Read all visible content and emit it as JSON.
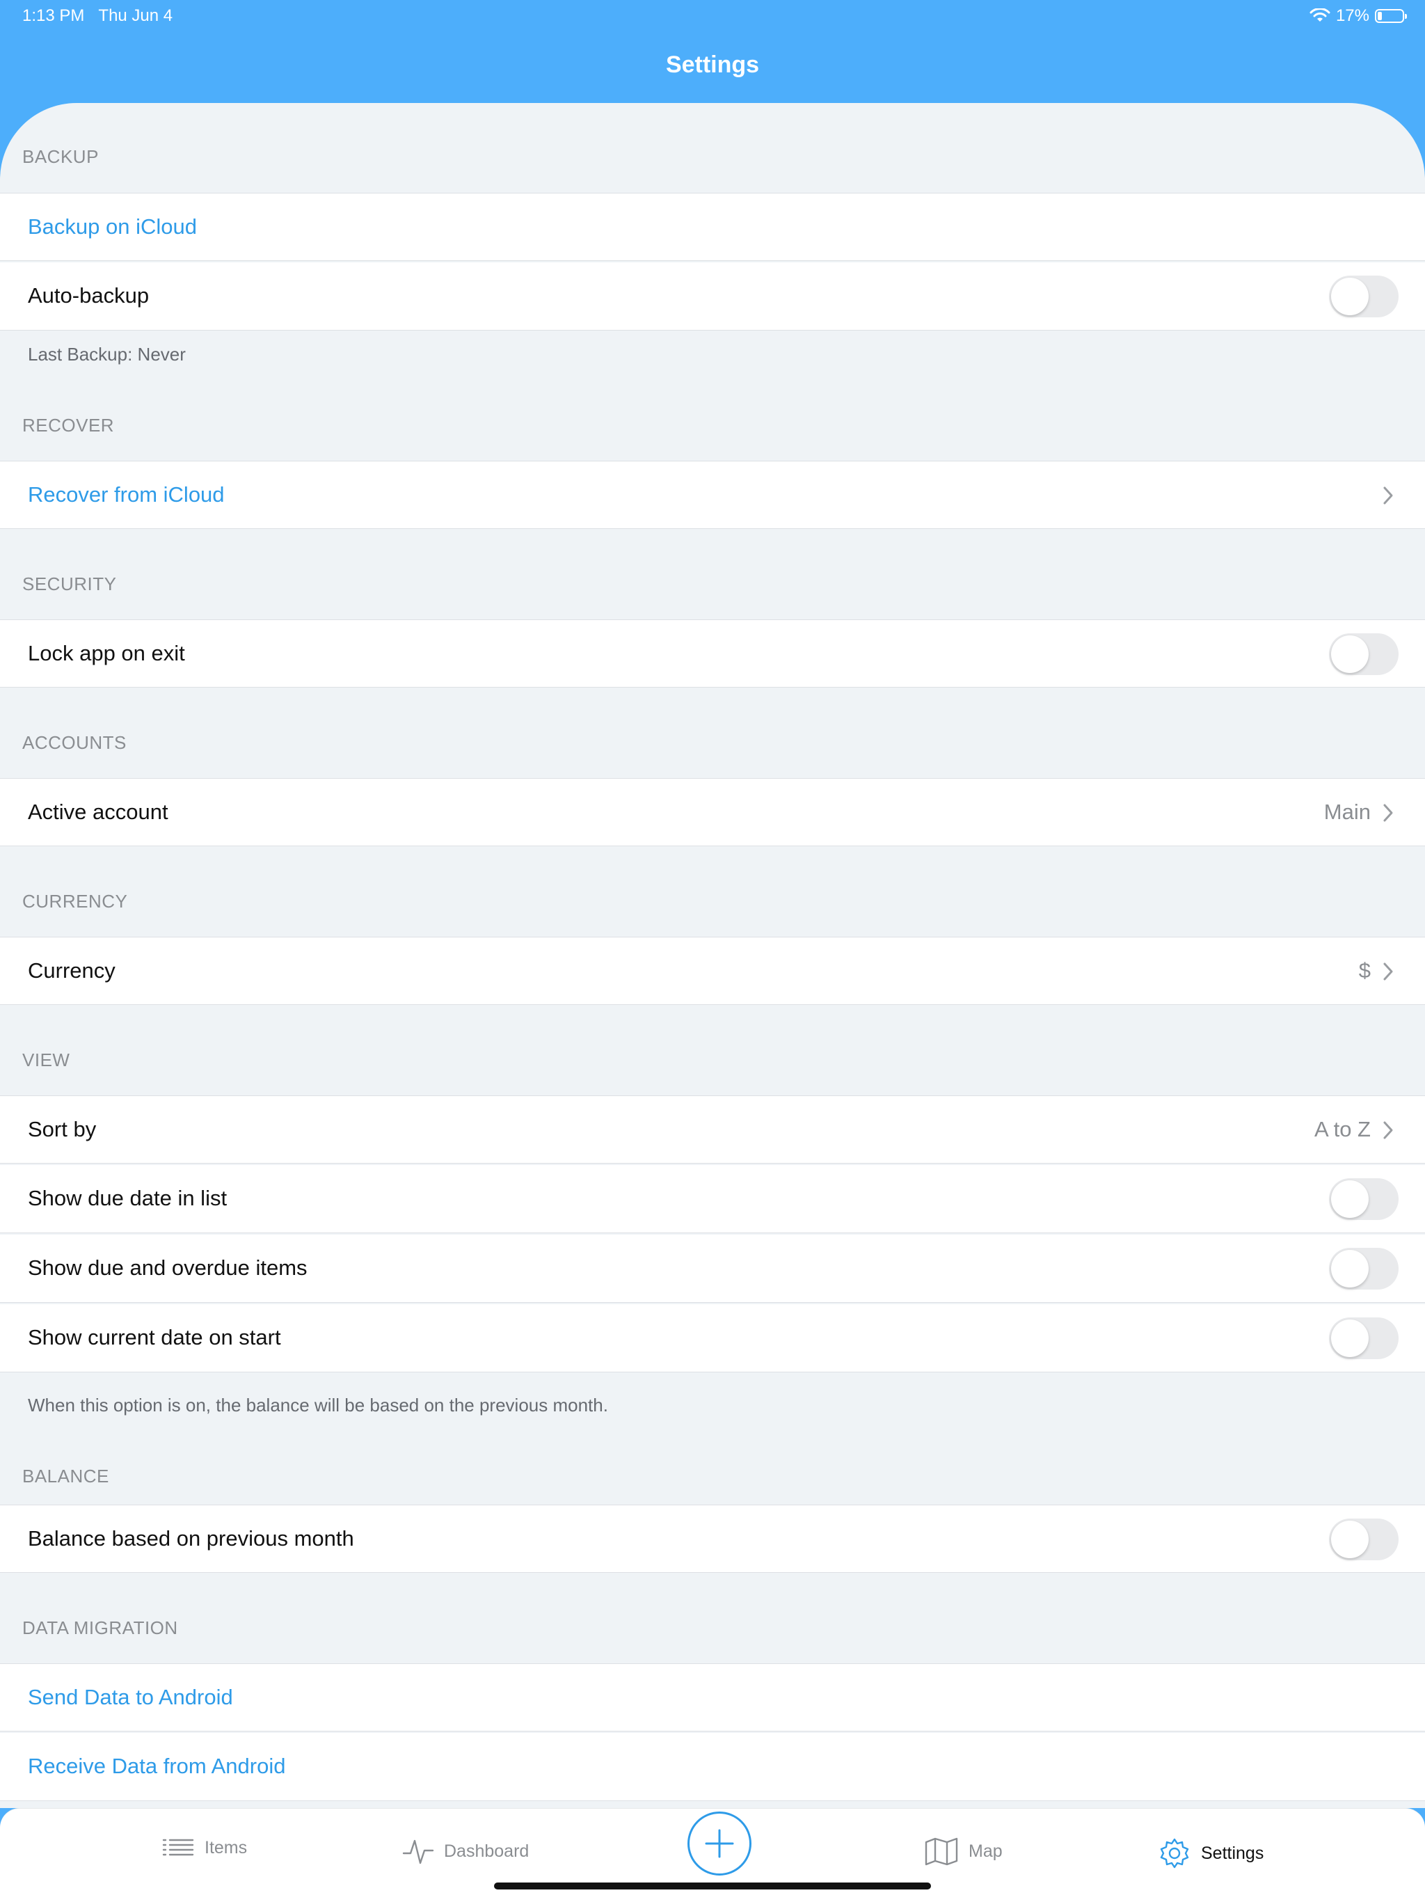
{
  "status_bar": {
    "time": "1:13 PM",
    "date": "Thu Jun 4",
    "battery_text": "17%",
    "battery_level": 0.17
  },
  "nav": {
    "title": "Settings"
  },
  "sections": {
    "backup": {
      "header": "BACKUP",
      "backup_icloud": "Backup on iCloud",
      "auto_backup": "Auto-backup",
      "footer": "Last Backup: Never"
    },
    "recover": {
      "header": "RECOVER",
      "recover_icloud": "Recover from iCloud"
    },
    "security": {
      "header": "SECURITY",
      "lock_app": "Lock app on exit"
    },
    "accounts": {
      "header": "ACCOUNTS",
      "active_account": "Active account",
      "active_account_value": "Main"
    },
    "currency": {
      "header": "CURRENCY",
      "currency": "Currency",
      "currency_value": "$"
    },
    "view": {
      "header": "VIEW",
      "sort_by": "Sort by",
      "sort_by_value": "A to Z",
      "show_due_date": "Show due date in list",
      "show_due_overdue": "Show due and overdue items",
      "show_current_date": "Show current date on start",
      "footer": "When this option is on, the balance will be based on the previous month."
    },
    "balance": {
      "header": "BALANCE",
      "balance_prev_month": "Balance based on previous month"
    },
    "data_migration": {
      "header": "DATA MIGRATION",
      "send_android": "Send Data to Android",
      "receive_android": "Receive Data from Android"
    }
  },
  "toggles": {
    "auto_backup": false,
    "lock_app": false,
    "show_due_date": false,
    "show_due_overdue": false,
    "show_current_date": false,
    "balance_prev_month": false
  },
  "tab_bar": {
    "items": "Items",
    "dashboard": "Dashboard",
    "map": "Map",
    "settings": "Settings",
    "active": "settings"
  },
  "colors": {
    "accent": "#4daefb",
    "link": "#2e9be8",
    "background": "#eff3f6"
  }
}
